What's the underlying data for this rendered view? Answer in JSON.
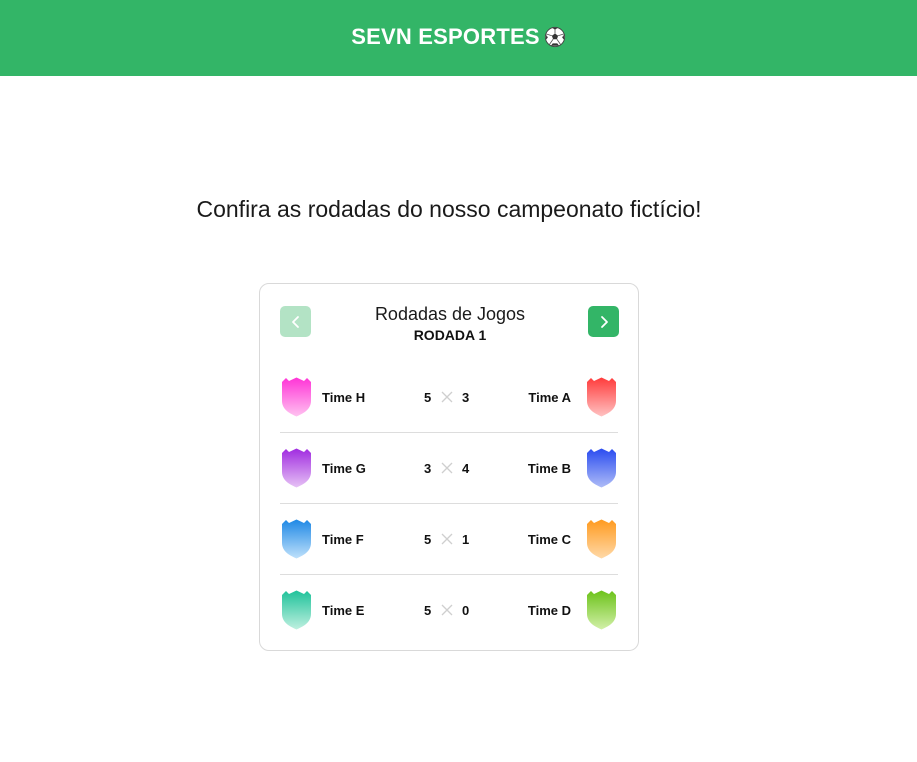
{
  "header": {
    "brand": "SEVN ESPORTES",
    "brand_icon": "soccer-ball-icon",
    "background": "#33b567"
  },
  "main": {
    "tagline": "Confira as rodadas do nosso campeonato fictício!"
  },
  "card": {
    "title": "Rodadas de Jogos",
    "round": "RODADA 1",
    "prev_icon": "chevron-left-icon",
    "next_icon": "chevron-right-icon",
    "matches": [
      {
        "home": {
          "name": "Time H",
          "score": "5",
          "color_top": "#ff33d6",
          "color_bottom": "#ffc2f0"
        },
        "away": {
          "name": "Time A",
          "score": "3",
          "color_top": "#ff3b3b",
          "color_bottom": "#ffc2c2"
        }
      },
      {
        "home": {
          "name": "Time G",
          "score": "3",
          "color_top": "#a02be0",
          "color_bottom": "#e6c2f5"
        },
        "away": {
          "name": "Time B",
          "score": "4",
          "color_top": "#2a4cf0",
          "color_bottom": "#aebcf7"
        }
      },
      {
        "home": {
          "name": "Time F",
          "score": "5",
          "color_top": "#1e88e5",
          "color_bottom": "#bfe1fb"
        },
        "away": {
          "name": "Time C",
          "score": "1",
          "color_top": "#ff9a1f",
          "color_bottom": "#ffd9a8"
        }
      },
      {
        "home": {
          "name": "Time E",
          "score": "5",
          "color_top": "#1fc29a",
          "color_bottom": "#bff0e0"
        },
        "away": {
          "name": "Time D",
          "score": "0",
          "color_top": "#6cc21a",
          "color_bottom": "#d2f0a8"
        }
      }
    ]
  }
}
